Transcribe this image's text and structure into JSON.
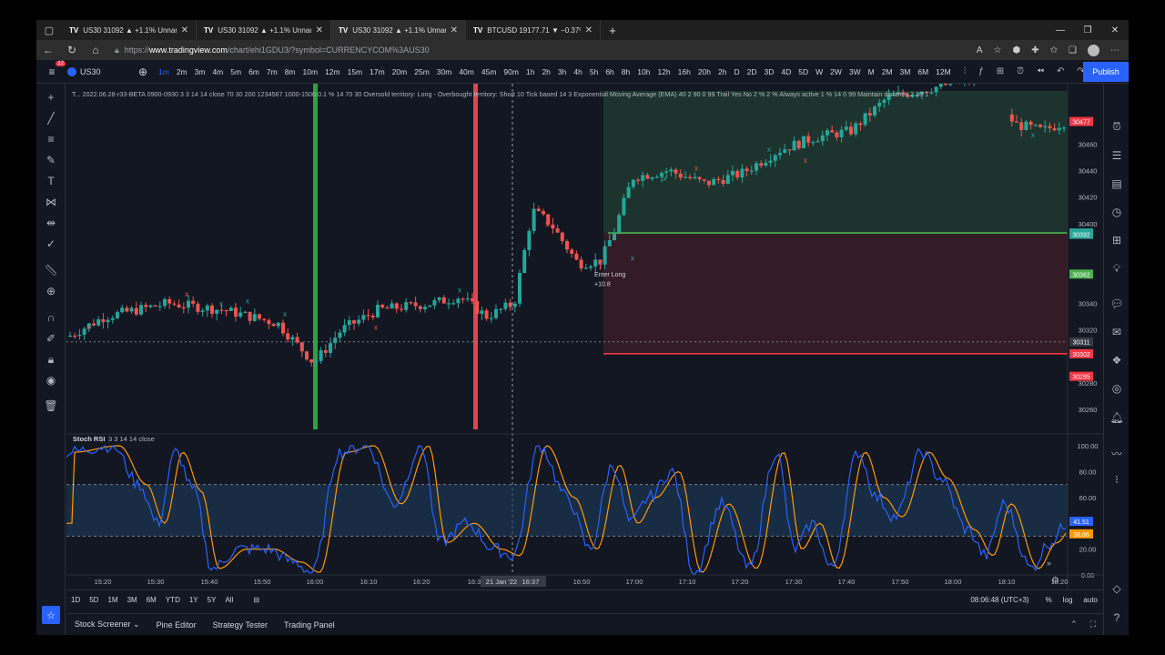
{
  "browser": {
    "tabs": [
      {
        "logo": "TV",
        "title": "US30 31092 ▲ +1.1% Unnamed"
      },
      {
        "logo": "TV",
        "title": "US30 31092 ▲ +1.1% Unnamed"
      },
      {
        "logo": "TV",
        "title": "US30 31092 ▲ +1.1% Unnamed"
      },
      {
        "logo": "TV",
        "title": "BTCUSD 19177.71 ▼ −0.37% Ra"
      }
    ],
    "url_prefix": "https://",
    "url_host": "www.tradingview.com",
    "url_path": "/chart/ehi1GDU3/?symbol=CURRENCYCOM%3AUS30"
  },
  "toolbar": {
    "menu_badge": "12",
    "symbol": "US30",
    "intervals": [
      "1m",
      "2m",
      "3m",
      "4m",
      "5m",
      "6m",
      "7m",
      "8m",
      "10m",
      "12m",
      "15m",
      "17m",
      "20m",
      "25m",
      "30m",
      "40m",
      "45m",
      "90m",
      "1h",
      "2h",
      "3h",
      "4h",
      "5h",
      "6h",
      "8h",
      "10h",
      "12h",
      "16h",
      "20h",
      "2h",
      "D",
      "2D",
      "3D",
      "4D",
      "5D",
      "W",
      "2W",
      "3W",
      "M",
      "2M",
      "3M",
      "6M",
      "12M"
    ],
    "active_interval": "1m",
    "publish_label": "Publish"
  },
  "indicator_header": "T... 2022.06.28-r33-BETA 0900-0930 3 3 14 14 close 70 30 200 1234567 1000-1500 0.1 % 14 70 30 Oversold territory: Long - Overbought territory: Short 10 Tick based 14 3 Exponential Moving Average (EMA) 40 2 90 0 99 Trail Yes No 2 % 2 % Always active 1 % 14 0 99 Maintain distance 2 20 1",
  "trade": {
    "label": "Enter Long",
    "value": "+10.8"
  },
  "price_axis": {
    "ticks": [
      "30460",
      "30440",
      "30420",
      "30400",
      "30340",
      "30320",
      "30280",
      "30260"
    ],
    "levels": [
      {
        "text": "30477",
        "color": "#f23645"
      },
      {
        "text": "30393",
        "color": "#26a69a"
      },
      {
        "text": "30392",
        "color": "#26a69a"
      },
      {
        "text": "30362",
        "color": "#4caf50"
      },
      {
        "text": "30311",
        "color": "#363a45"
      },
      {
        "text": "30302",
        "color": "#f23645"
      },
      {
        "text": "30285",
        "color": "#f23645"
      }
    ]
  },
  "stoch": {
    "label": "Stoch RSI",
    "params": "3 3 14 14 close",
    "ticks": [
      "100.00",
      "80.00",
      "60.00",
      "20.00",
      "0.00"
    ],
    "k_value": "41.51",
    "d_value": "38.86",
    "k_color": "#2962ff",
    "d_color": "#ff9800"
  },
  "time_axis": {
    "ticks": [
      "15:20",
      "15:30",
      "15:40",
      "15:50",
      "16:00",
      "16:10",
      "16:20",
      "16:3",
      "16:50",
      "17:00",
      "17:10",
      "17:20",
      "17:30",
      "17:40",
      "17:50",
      "18:00",
      "18:10",
      "18:20"
    ],
    "cursor_date": "21 Jan '22",
    "cursor_time": "16:37"
  },
  "range_bar": {
    "ranges": [
      "1D",
      "5D",
      "1M",
      "3M",
      "6M",
      "YTD",
      "1Y",
      "5Y",
      "All"
    ],
    "clock": "08:06:48 (UTC+3)",
    "pct": "%",
    "log": "log",
    "auto": "auto"
  },
  "bottom_panel": {
    "tabs": [
      "Stock Screener",
      "Pine Editor",
      "Strategy Tester",
      "Trading Panel"
    ]
  },
  "colors": {
    "up": "#26a69a",
    "down": "#ef5350",
    "bg": "#131722",
    "accent": "#2962ff",
    "entry_line": "#4caf50",
    "stop_line": "#f23645"
  }
}
